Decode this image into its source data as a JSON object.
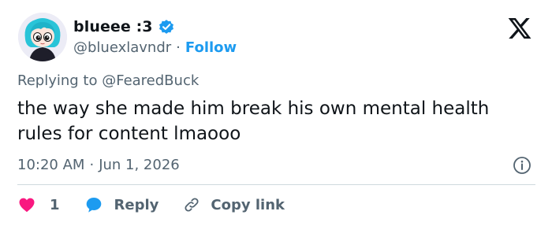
{
  "author": {
    "display_name": "blueee :3",
    "handle": "@bluexlavndr",
    "verified_badge": "verified-badge-icon",
    "avatar": "cartoon-avatar"
  },
  "follow_label": "Follow",
  "separator": "·",
  "platform_logo": "x-logo-icon",
  "reply_context": {
    "prefix": "Replying to ",
    "mention": "@FearedBuck"
  },
  "tweet_text": "the way she made him break his own mental health rules for content lmaooo",
  "meta": {
    "time": "10:20 AM",
    "date": "Jun 1, 2026"
  },
  "actions": {
    "like_count": "1",
    "reply_label": "Reply",
    "copy_link_label": "Copy link"
  },
  "colors": {
    "accent": "#1d9bf0",
    "like": "#f91880",
    "text": "#0f1419",
    "muted": "#536471",
    "divider": "#cfd9de"
  }
}
